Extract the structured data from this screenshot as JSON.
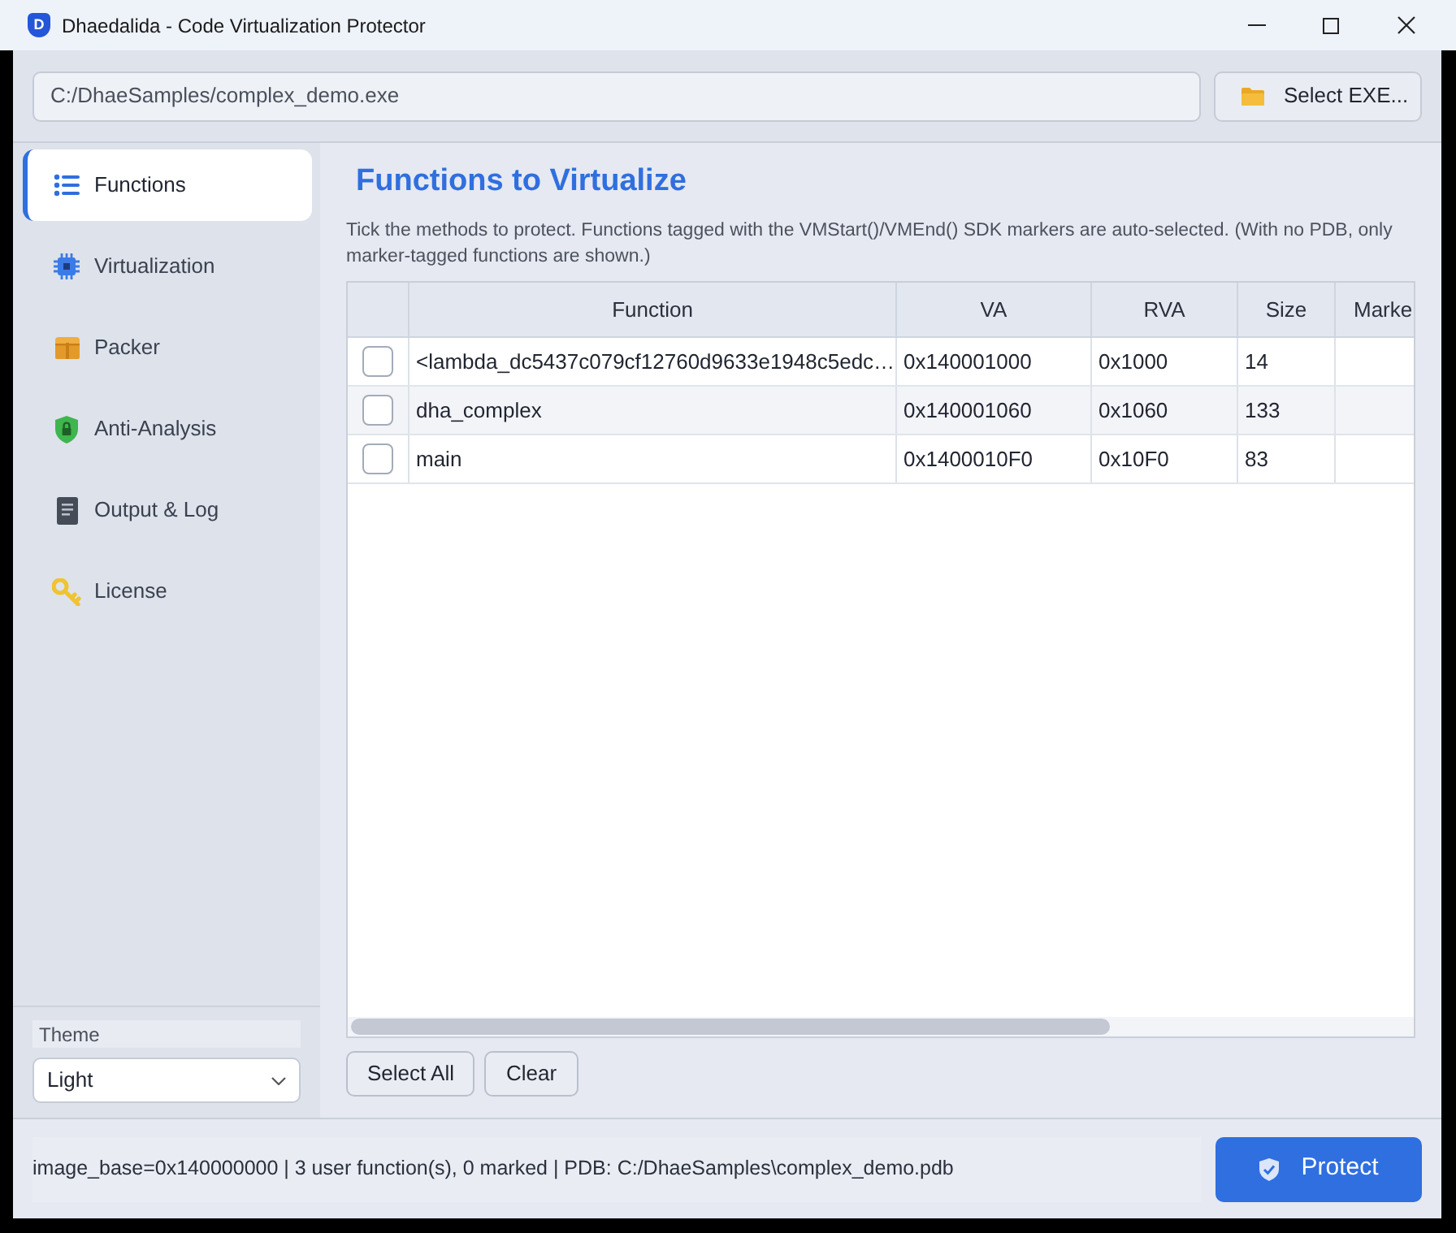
{
  "window": {
    "logo_letter": "D",
    "title": "Dhaedalida - Code Virtualization Protector"
  },
  "file_bar": {
    "path": "C:/DhaeSamples/complex_demo.exe",
    "button": "Select EXE..."
  },
  "sidebar": {
    "items": [
      {
        "label": "Functions",
        "selected": true
      },
      {
        "label": "Virtualization",
        "selected": false
      },
      {
        "label": "Packer",
        "selected": false
      },
      {
        "label": "Anti-Analysis",
        "selected": false
      },
      {
        "label": "Output & Log",
        "selected": false
      },
      {
        "label": "License",
        "selected": false
      }
    ],
    "theme": {
      "label": "Theme",
      "value": "Light"
    }
  },
  "panel": {
    "title": "Functions to Virtualize",
    "description": "Tick the methods to protect. Functions tagged with the VMStart()/VMEnd() SDK markers are auto-selected. (With no PDB, only marker-tagged functions are shown.)",
    "table": {
      "columns": [
        "Function",
        "VA",
        "RVA",
        "Size",
        "Marke"
      ],
      "rows": [
        {
          "checked": false,
          "function": "<lambda_dc5437c079cf12760d9633e1948c5edc…",
          "va": "0x140001000",
          "rva": "0x1000",
          "size": "14"
        },
        {
          "checked": false,
          "function": "dha_complex",
          "va": "0x140001060",
          "rva": "0x1060",
          "size": "133"
        },
        {
          "checked": false,
          "function": "main",
          "va": "0x1400010F0",
          "rva": "0x10F0",
          "size": "83"
        }
      ]
    },
    "buttons": [
      "Select All",
      "Clear"
    ]
  },
  "status_bar": {
    "text": "image_base=0x140000000 | 3 user function(s), 0 marked | PDB: C:/DhaeSamples\\complex_demo.pdb",
    "button": "Protect"
  }
}
